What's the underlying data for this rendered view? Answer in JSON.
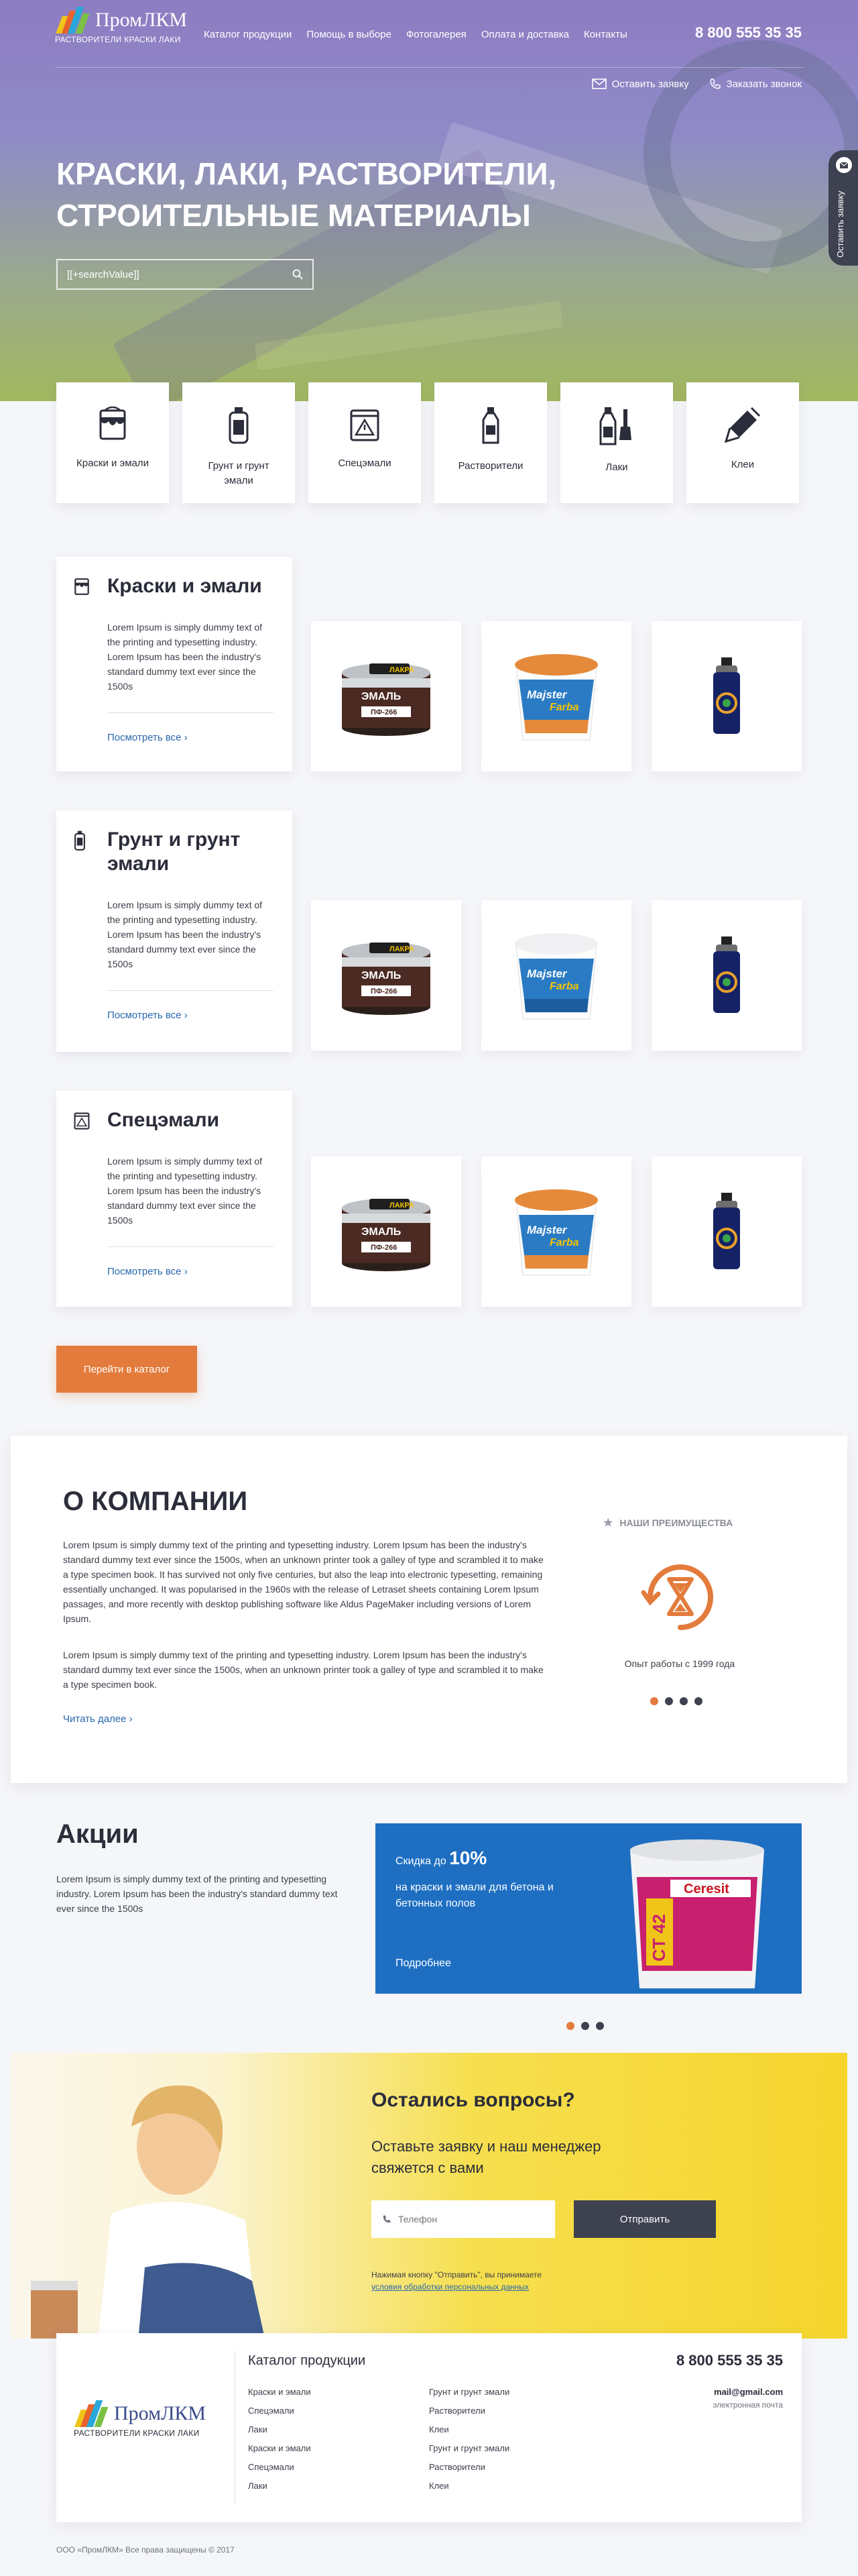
{
  "header": {
    "logo_text": "ПромЛКМ",
    "logo_sub": "РАСТВОРИТЕЛИ КРАСКИ ЛАКИ",
    "nav": [
      "Каталог продукции",
      "Помощь в выборе",
      "Фотогалерея",
      "Оплата и доставка",
      "Контакты"
    ],
    "phone": "8 800 555 35 35",
    "action_request": "Оставить заявку",
    "action_call": "Заказать звонок"
  },
  "hero": {
    "title": "Краски, лаки, растворители, строительные материалы",
    "search_value": "[[+searchValue]]"
  },
  "side_tab": {
    "label": "Оставить заявку"
  },
  "categories": [
    {
      "label": "Краски и эмали",
      "icon": "paint-can-icon"
    },
    {
      "label": "Грунт и грунт эмали",
      "icon": "primer-bottle-icon"
    },
    {
      "label": "Спецэмали",
      "icon": "warning-can-icon"
    },
    {
      "label": "Растворители",
      "icon": "solvent-bottle-icon"
    },
    {
      "label": "Лаки",
      "icon": "varnish-brush-icon"
    },
    {
      "label": "Клеи",
      "icon": "glue-gun-icon"
    }
  ],
  "product_sections": [
    {
      "title": "Краски и эмали",
      "text": "Lorem Ipsum is simply dummy text of the printing and typesetting industry. Lorem Ipsum has been the industry's standard dummy text ever since the 1500s",
      "more": "Посмотреть все"
    },
    {
      "title": "Грунт и грунт эмали",
      "text": "Lorem Ipsum is simply dummy text of the printing and typesetting industry. Lorem Ipsum has been the industry's standard dummy text ever since the 1500s",
      "more": "Посмотреть все"
    },
    {
      "title": "Спецэмали",
      "text": "Lorem Ipsum is simply dummy text of the printing and typesetting industry. Lorem Ipsum has been the industry's standard dummy text ever since the 1500s",
      "more": "Посмотреть все"
    }
  ],
  "product_labels": {
    "lakra_brand": "ЛАКРА",
    "lakra_name": "ЭМАЛЬ",
    "lakra_code": "ПФ-266",
    "majster_brand": "Majster",
    "majster_brand2": "Farba"
  },
  "catalog_button": "Перейти в каталог",
  "about": {
    "title": "О КОМПАНИИ",
    "text1": "Lorem Ipsum is simply dummy text of the printing and typesetting industry. Lorem Ipsum has been the industry's standard dummy text ever since the 1500s, when an unknown printer took a galley of type and scrambled it to make a type specimen book. It has survived not only five centuries, but also the leap into electronic typesetting, remaining essentially unchanged. It was popularised in the 1960s with the release of Letraset sheets containing Lorem Ipsum passages, and more recently with desktop publishing software like Aldus PageMaker including versions of Lorem Ipsum.",
    "text2": "Lorem Ipsum is simply dummy text of the printing and typesetting industry. Lorem Ipsum has been the industry's standard dummy text ever since the 1500s, when an unknown printer took a galley of type and scrambled it to make a type specimen book.",
    "more": "Читать далее",
    "advantages_title": "НАШИ ПРЕИМУЩЕСТВА",
    "advantage_text": "Опыт работы с 1999 года"
  },
  "promo": {
    "title": "Акции",
    "text": "Lorem Ipsum is simply dummy text of the printing and typesetting industry. Lorem Ipsum has been the industry's standard dummy text ever since the 1500s",
    "banner_prefix": "Скидка до",
    "banner_percent": "10%",
    "banner_text": "на краски и эмали для бетона и бетонных полов",
    "banner_more": "Подробнее",
    "banner_brand": "Ceresit",
    "banner_code": "CT 42"
  },
  "contact": {
    "title": "Остались вопросы?",
    "subtitle": "Оставьте заявку и наш менеджер свяжется с вами",
    "phone_placeholder": "Телефон",
    "send": "Отправить",
    "note": "Нажимая кнопку \"Отправить\", вы принимаете",
    "note_link": "условия обработки персональных данных"
  },
  "footer": {
    "catalog_title": "Каталог продукции",
    "col1": [
      "Краски и эмали",
      "Спецэмали",
      "Лаки",
      "Краски и эмали",
      "Спецэмали",
      "Лаки"
    ],
    "col2": [
      "Грунт и грунт эмали",
      "Растворители",
      "Клеи",
      "Грунт и грунт эмали",
      "Растворители",
      "Клеи"
    ],
    "phone": "8 800 555 35 35",
    "email": "mail@gmail.com",
    "email_label": "электронная почта",
    "copyright": "ООО «ПромЛКМ» Все права защищены © 2017"
  },
  "colors": {
    "accent": "#e37b3c",
    "dark": "#3d4150",
    "link": "#2868ad",
    "banner_blue": "#1e6fc2"
  }
}
